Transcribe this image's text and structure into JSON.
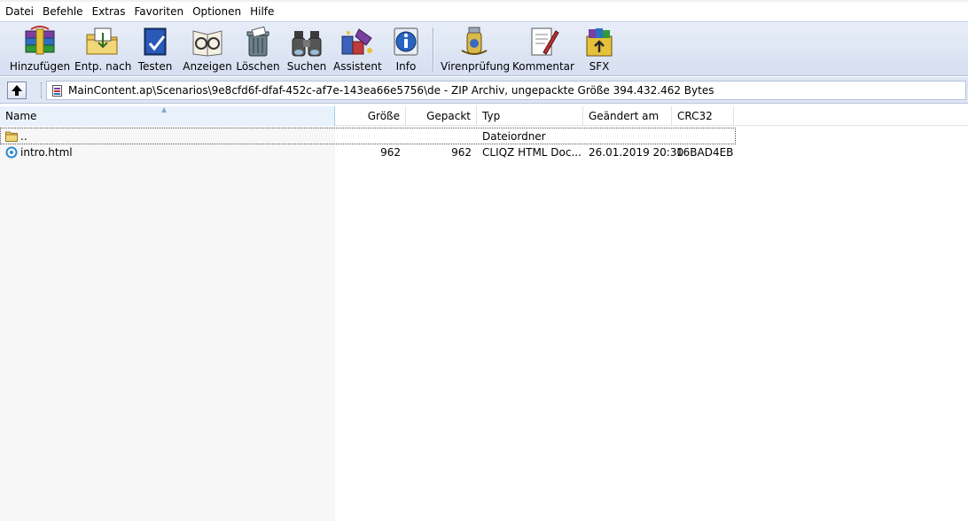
{
  "menu": [
    "Datei",
    "Befehle",
    "Extras",
    "Favoriten",
    "Optionen",
    "Hilfe"
  ],
  "toolbar": {
    "buttons": [
      {
        "label": "Hinzufügen",
        "icon": "add-archive-icon"
      },
      {
        "label": "Entp. nach",
        "icon": "extract-folder-icon"
      },
      {
        "label": "Testen",
        "icon": "test-book-icon"
      },
      {
        "label": "Anzeigen",
        "icon": "view-glasses-icon"
      },
      {
        "label": "Löschen",
        "icon": "delete-trash-icon"
      },
      {
        "label": "Suchen",
        "icon": "find-binoculars-icon"
      },
      {
        "label": "Assistent",
        "icon": "wizard-icon"
      },
      {
        "label": "Info",
        "icon": "info-icon"
      },
      {
        "label": "Virenprüfung",
        "icon": "virus-scan-icon"
      },
      {
        "label": "Kommentar",
        "icon": "comment-pen-icon"
      },
      {
        "label": "SFX",
        "icon": "sfx-archive-icon"
      }
    ]
  },
  "address": {
    "path": "MainContent.ap\\Scenarios\\9e8cfd6f-dfaf-452c-af7e-143ea66e5756\\de - ZIP Archiv, ungepackte Größe 394.432.462 Bytes"
  },
  "columns": {
    "name": "Name",
    "size": "Größe",
    "packed": "Gepackt",
    "type": "Typ",
    "modified": "Geändert am",
    "crc": "CRC32"
  },
  "rows": [
    {
      "name": "..",
      "size": "",
      "packed": "",
      "type": "Dateiordner",
      "modified": "",
      "crc": "",
      "icon": "folder-icon"
    },
    {
      "name": "intro.html",
      "size": "962",
      "packed": "962",
      "type": "CLIQZ HTML Doc...",
      "modified": "26.01.2019 20:30",
      "crc": "16BAD4EB",
      "icon": "html-file-icon"
    }
  ],
  "colors": {
    "toolbar_top": "#e8eef8",
    "toolbar_bottom": "#d6dff1",
    "name_column_header": "#e9f2fb"
  }
}
